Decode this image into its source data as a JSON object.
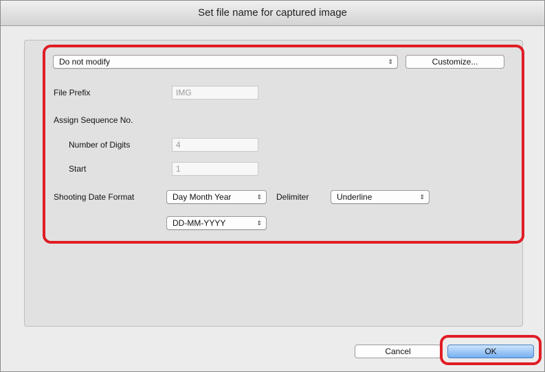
{
  "window": {
    "title": "Set file name for captured image"
  },
  "preset": {
    "selected": "Do not modify",
    "customize_label": "Customize..."
  },
  "file_prefix": {
    "label": "File Prefix",
    "value": "IMG"
  },
  "sequence": {
    "label": "Assign Sequence No.",
    "digits_label": "Number of Digits",
    "digits_value": "4",
    "start_label": "Start",
    "start_value": "1"
  },
  "date": {
    "label": "Shooting Date Format",
    "format_selected": "Day Month Year",
    "delimiter_label": "Delimiter",
    "delimiter_selected": "Underline",
    "pattern_selected": "DD-MM-YYYY"
  },
  "footer": {
    "cancel_label": "Cancel",
    "ok_label": "OK"
  },
  "colors": {
    "highlight": "#e01d25",
    "default_button": "#74aef2"
  },
  "icons": {
    "popup_arrows": "updown-arrows-icon"
  }
}
